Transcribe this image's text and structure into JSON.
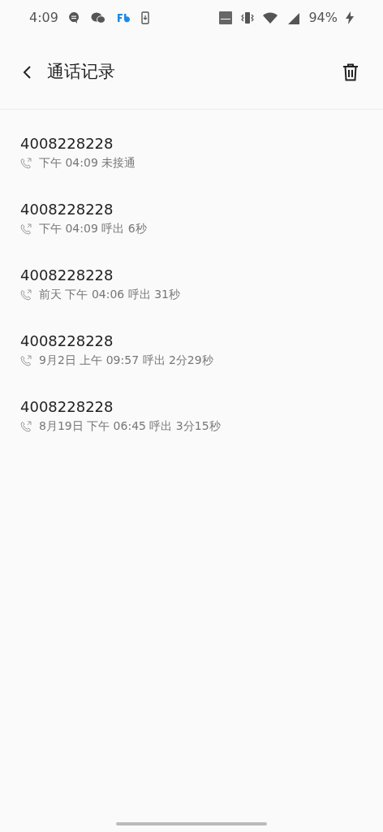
{
  "status_bar": {
    "time": "4:09",
    "battery": "94%"
  },
  "header": {
    "title": "通话记录"
  },
  "calls": [
    {
      "number": "4008228228",
      "detail": "下午 04:09 未接通"
    },
    {
      "number": "4008228228",
      "detail": "下午 04:09 呼出 6秒"
    },
    {
      "number": "4008228228",
      "detail": "前天 下午 04:06 呼出 31秒"
    },
    {
      "number": "4008228228",
      "detail": "9月2日 上午 09:57 呼出 2分29秒"
    },
    {
      "number": "4008228228",
      "detail": "8月19日 下午 06:45 呼出 3分15秒"
    }
  ]
}
